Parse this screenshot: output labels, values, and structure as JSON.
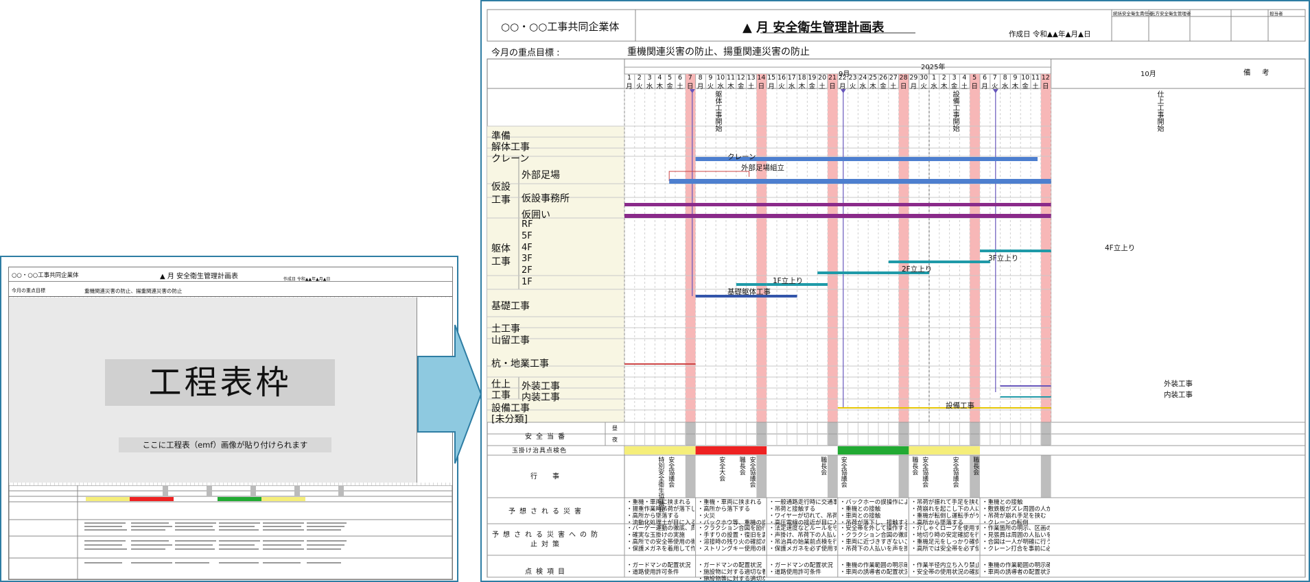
{
  "left_preview": {
    "company": "○○・○○工事共同企業体",
    "title": "▲ 月 安全衛生管理計画表",
    "goal_label": "今月の重点目標",
    "goal_text": "重機関連災害の防止、揚重関連災害の防止",
    "created": "作成日 令和▲▲年▲月▲日",
    "remarks": "備　考",
    "frame_label": "工程表枠",
    "frame_note": "ここに工程表（emf）画像が貼り付けられます"
  },
  "header": {
    "company": "○○・○○工事共同企業体",
    "title": "▲ 月 安全衛生管理計画表",
    "created": "作成日 令和▲▲年▲月▲日",
    "approvers": [
      "統括安全衛生責任者",
      "元方安全衛生管理者",
      "",
      "",
      "担当者"
    ],
    "goal_label": "今月の重点目標 :",
    "goal_text": "重機関連災害の防止、揚重関連災害の防止",
    "remarks": "備　考"
  },
  "calendar": {
    "year": "2025年",
    "months": [
      "9月",
      "10月"
    ],
    "days": [
      {
        "d": "1",
        "w": "月"
      },
      {
        "d": "2",
        "w": "火"
      },
      {
        "d": "3",
        "w": "水"
      },
      {
        "d": "4",
        "w": "木"
      },
      {
        "d": "5",
        "w": "金"
      },
      {
        "d": "6",
        "w": "土"
      },
      {
        "d": "7",
        "w": "日"
      },
      {
        "d": "8",
        "w": "月"
      },
      {
        "d": "9",
        "w": "火"
      },
      {
        "d": "10",
        "w": "水"
      },
      {
        "d": "11",
        "w": "木"
      },
      {
        "d": "12",
        "w": "金"
      },
      {
        "d": "13",
        "w": "土"
      },
      {
        "d": "14",
        "w": "日"
      },
      {
        "d": "15",
        "w": "月"
      },
      {
        "d": "16",
        "w": "火"
      },
      {
        "d": "17",
        "w": "水"
      },
      {
        "d": "18",
        "w": "木"
      },
      {
        "d": "19",
        "w": "金"
      },
      {
        "d": "20",
        "w": "土"
      },
      {
        "d": "21",
        "w": "日"
      },
      {
        "d": "22",
        "w": "月"
      },
      {
        "d": "23",
        "w": "火"
      },
      {
        "d": "24",
        "w": "水"
      },
      {
        "d": "25",
        "w": "木"
      },
      {
        "d": "26",
        "w": "金"
      },
      {
        "d": "27",
        "w": "土"
      },
      {
        "d": "28",
        "w": "日"
      },
      {
        "d": "29",
        "w": "月"
      },
      {
        "d": "30",
        "w": "火"
      },
      {
        "d": "1",
        "w": "水"
      },
      {
        "d": "2",
        "w": "木"
      },
      {
        "d": "3",
        "w": "金"
      },
      {
        "d": "4",
        "w": "土"
      },
      {
        "d": "5",
        "w": "日"
      },
      {
        "d": "6",
        "w": "月"
      },
      {
        "d": "7",
        "w": "火"
      },
      {
        "d": "8",
        "w": "水"
      },
      {
        "d": "9",
        "w": "木"
      },
      {
        "d": "10",
        "w": "金"
      },
      {
        "d": "11",
        "w": "土"
      },
      {
        "d": "12",
        "w": "日"
      }
    ],
    "sundays": [
      6,
      13,
      20,
      27,
      34,
      41
    ],
    "milestones": [
      {
        "label": "躯体工事開始",
        "day": 6
      },
      {
        "label": "設備工事開始",
        "day": 21
      },
      {
        "label": "仕上工事開始",
        "day": 36
      }
    ]
  },
  "categories": {
    "junbi": "準備",
    "kaitai": "解体工事",
    "crane": "クレーン",
    "kasetsu": "仮設\n工事",
    "sotoashiba": "外部足場",
    "jimusho": "仮設事務所",
    "kagakoi": "仮囲い",
    "kutai": "躯体\n工事",
    "floors": [
      "RF",
      "5F",
      "4F",
      "3F",
      "2F",
      "1F"
    ],
    "kiso": "基礎工事",
    "doko": "土工事",
    "yamadome": "山留工事",
    "kui": "杭・地業工事",
    "shiage": "仕上\n工事",
    "gaiso": "外装工事",
    "naiso": "内装工事",
    "setsubi": "設備工事",
    "mibunrui": "[未分類]"
  },
  "bar_labels": {
    "crane": "クレーン",
    "ashiba": "外部足場組立",
    "f1": "1F立上り",
    "f2": "2F立上り",
    "f3": "3F立上り",
    "f4": "4F立上り",
    "kiso": "基礎躯体工事",
    "gaiso": "外装工事",
    "naiso": "内装工事",
    "setsubi": "設備工事"
  },
  "bottom": {
    "safety_duty": "安全当番",
    "day": "昼",
    "night": "夜",
    "tamakake": "玉掛け治具点検色",
    "tamakake_colors": [
      "#f5ee7a",
      "#ee2222",
      "#ffffff",
      "#22aa33",
      "#f5ee7a",
      "#ffffff"
    ],
    "events_label": "行　事",
    "events": [
      "特別安全衛生協議会",
      "安全協議会",
      "安全大会",
      "職長会",
      "安全協議会",
      "職長会",
      "安全協議会",
      "職長会",
      "安全協議会",
      "安全協議会",
      "職長会"
    ],
    "hazards_label": "予想される災害",
    "hazards": [
      "・重機・車両に挟まれる\n・揚重作業時吊荷が落下しケガをする\n・高所から墜落する\n・流動化処理土が目に入る",
      "・重機・車両に挟まれる\n・高所から落下する\n・火災\n・バックホウ等、重機の誤操作",
      "・一般通路走行時に交通事故を起こす\n・吊荷と接触する\n・ワイヤーが切れて、吊荷に挟まれる\n・高圧電線の接近が目に入る",
      "・バックホーの誤操作による挟まれ災害\n・重機との接触\n・車両との接触\n・吊荷が落下し、接触する",
      "・吊荷が振れて手足を挟む\n・荷崩れを起こし下の人にケガをさせる\n・重機が転倒し運転手がケガをする\n・高所から墜落する",
      "・重機との接触\n・敷鉄板がズレ周囲の人がケガをする\n・吊荷が崩れ手足を挟む\n・クレーンの転倒"
    ],
    "prevention_label": "予想される災害への防止対策",
    "prevention": [
      "・バーゲー運動の徹底、周囲の確認の徹底\n・確実な玉掛けの実施\n・高所での安全帯使用の徹底\n・保護メガネを着用して作業する",
      "・クラクション合図を励行する\n・手すりの設置・復旧を漏れず行う\n・溶接時の残り火の確認の徹底\n・ストリングキー使用の徹底",
      "・法定速度などルールを守る\n・声掛け、吊荷下の人払いを徹底する\n・吊治具の始業前点検を行う\n・保護メガネを必ず使用すること",
      "・安全帯を外して操作する\n・クラクション合図の徹底\n・車両に近づきすぎないこと、合図徹底\n・吊荷下の人払いを声を掛け合い行う",
      "・介しゃくロープを使用する\n・地切り時の安定確認を行う\n・重機足元をしっかり確保して運転する\n・高所では安全帯を必ず使用する",
      "・作業箇所の明示、区画の徹底\n・見張員は周囲の人払いをの徹底\n・合図は一人が明確に行う\n・クレーン打合を事前に必ず実施する"
    ],
    "check_label": "点検項目",
    "checks": [
      "・ガードマンの配置状況\n・道路使用許可条件",
      "・ガードマンの配置状況\n・施設物に対する適切な養生の設置状況\n・施設物等に対する適切な養生の設置状況",
      "・ガードマンの配置状況\n・道路使用許可条件",
      "・重機の作業範囲の明示確認\n・車両の誘導者の配置状況の確認",
      "・作業半径内立ち入り禁止措置の確認\n・安全帯の使用状況の確認",
      "・重機の作業範囲の明示確認\n・車両の誘導者の配置状況の確認"
    ]
  },
  "arrow_color": "#8ec9e0",
  "panel_border_color": "#2e7da3"
}
